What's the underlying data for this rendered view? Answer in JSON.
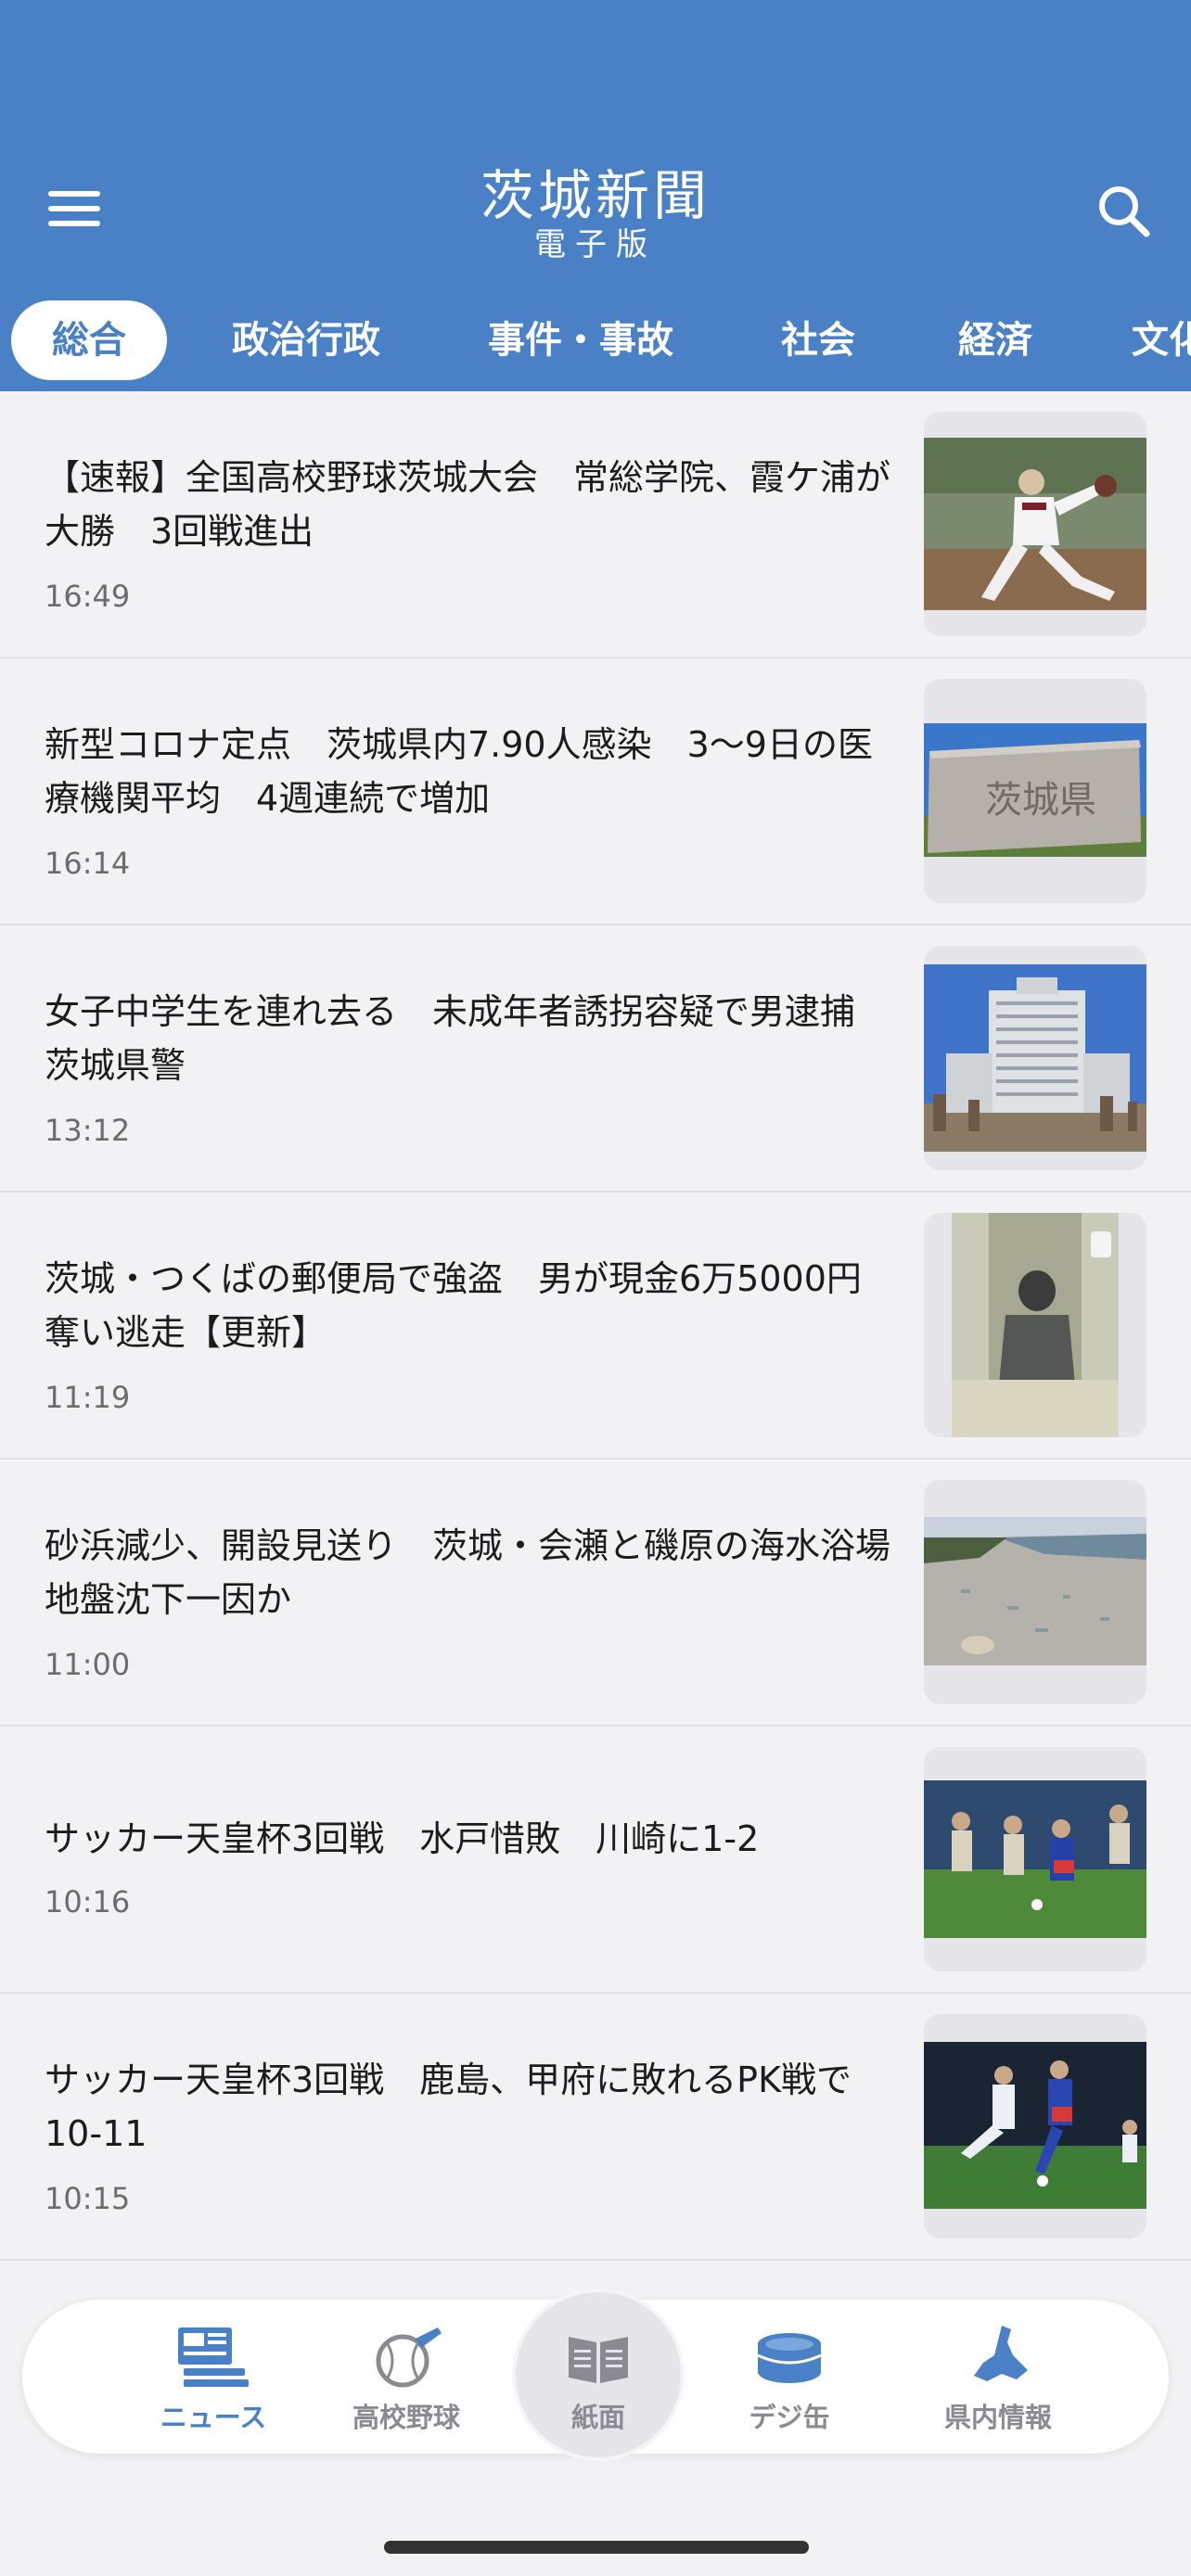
{
  "app": {
    "logo_main": "茨城新聞",
    "logo_sub": "電子版"
  },
  "tabs": [
    {
      "label": "総合",
      "active": true
    },
    {
      "label": "政治行政",
      "active": false
    },
    {
      "label": "事件・事故",
      "active": false
    },
    {
      "label": "社会",
      "active": false
    },
    {
      "label": "経済",
      "active": false
    },
    {
      "label": "文化",
      "active": false
    }
  ],
  "articles": [
    {
      "title": "【速報】全国高校野球茨城大会　常総学院、霞ケ浦が大勝　3回戦進出",
      "time": "16:49",
      "thumbnail": "baseball-pitcher"
    },
    {
      "title": "新型コロナ定点　茨城県内7.90人感染　3〜9日の医療機関平均　4週連続で増加",
      "time": "16:14",
      "thumbnail": "prefecture-office-sign"
    },
    {
      "title": "女子中学生を連れ去る　未成年者誘拐容疑で男逮捕　茨城県警",
      "time": "13:12",
      "thumbnail": "police-headquarters-building"
    },
    {
      "title": "茨城・つくばの郵便局で強盗　男が現金6万5000円奪い逃走【更新】",
      "time": "11:19",
      "thumbnail": "security-camera-still"
    },
    {
      "title": "砂浜減少、開設見送り　茨城・会瀬と磯原の海水浴場　地盤沈下一因か",
      "time": "11:00",
      "thumbnail": "beach"
    },
    {
      "title": "サッカー天皇杯3回戦　水戸惜敗　川崎に1-2",
      "time": "10:16",
      "thumbnail": "soccer-match"
    },
    {
      "title": "サッカー天皇杯3回戦　鹿島、甲府に敗れるPK戦で10-11",
      "time": "10:15",
      "thumbnail": "soccer-match-night"
    }
  ],
  "bottom_nav": [
    {
      "label": "ニュース",
      "icon": "news-icon",
      "active": true
    },
    {
      "label": "高校野球",
      "icon": "baseball-icon",
      "active": false
    },
    {
      "label": "紙面",
      "icon": "newspaper-icon",
      "active": false
    },
    {
      "label": "デジ缶",
      "icon": "digi-can-icon",
      "active": false
    },
    {
      "label": "県内情報",
      "icon": "ibaraki-map-icon",
      "active": false
    }
  ],
  "colors": {
    "brand": "#4a80c5",
    "background": "#f2f2f5",
    "text": "#1c1c1c",
    "time": "#6b6b70",
    "nav_inactive": "#8a8a90"
  }
}
